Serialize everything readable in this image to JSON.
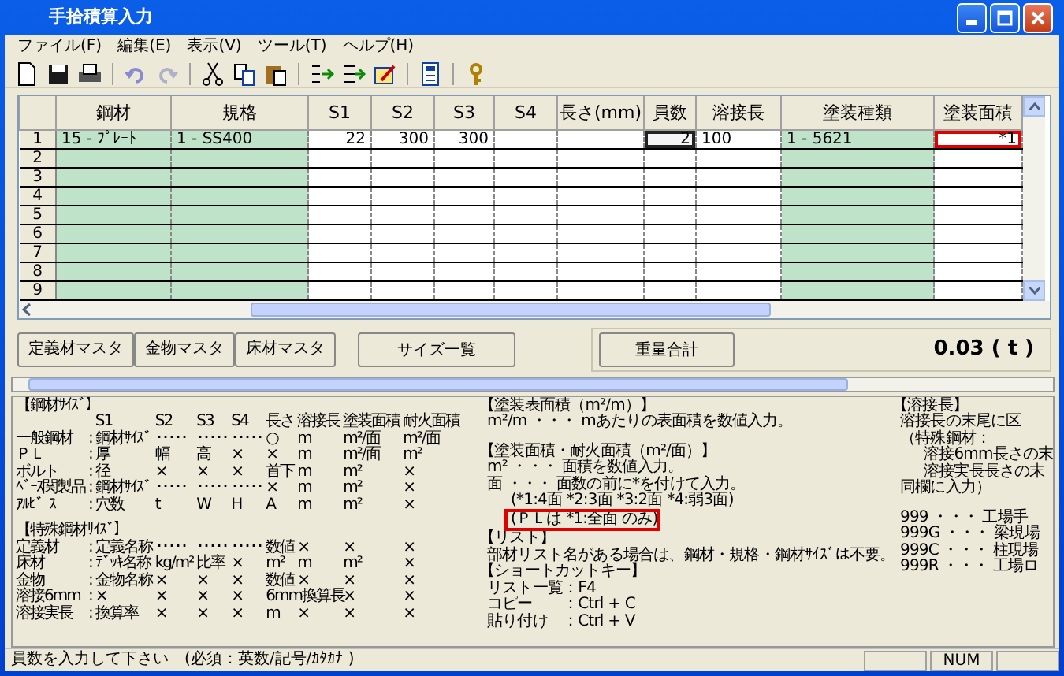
{
  "window": {
    "title": "手拾積算入力"
  },
  "menu": [
    "ファイル(F)",
    "編集(E)",
    "表示(V)",
    "ツール(T)",
    "ヘルプ(H)"
  ],
  "grid": {
    "columns": [
      {
        "label": "鋼材",
        "kind": "list"
      },
      {
        "label": "規格",
        "kind": "list"
      },
      {
        "label": "S1",
        "kind": "number"
      },
      {
        "label": "S2",
        "kind": "number"
      },
      {
        "label": "S3",
        "kind": "number"
      },
      {
        "label": "S4",
        "kind": "number"
      },
      {
        "label": "長さ(mm)",
        "kind": "number"
      },
      {
        "label": "員数",
        "kind": "number"
      },
      {
        "label": "溶接長",
        "kind": "text"
      },
      {
        "label": "塗装種類",
        "kind": "list"
      },
      {
        "label": "塗装面積",
        "kind": "number"
      }
    ],
    "rows": [
      {
        "label": "1",
        "cells": [
          {
            "text": "15 - ﾌﾟﾚｰﾄ",
            "selected": false,
            "highlighted": false
          },
          {
            "text": "1 - SS400",
            "selected": false,
            "highlighted": false
          },
          {
            "text": "22",
            "selected": false,
            "highlighted": false
          },
          {
            "text": "300",
            "selected": false,
            "highlighted": false
          },
          {
            "text": "300",
            "selected": false,
            "highlighted": false
          },
          null,
          null,
          {
            "text": "2",
            "selected": true,
            "highlighted": false
          },
          {
            "text": "100",
            "selected": false,
            "highlighted": false
          },
          {
            "text": "1 - 5621",
            "selected": false,
            "highlighted": false
          },
          {
            "text": "*1",
            "selected": false,
            "highlighted": true
          }
        ]
      },
      {
        "label": "2"
      },
      {
        "label": "3"
      },
      {
        "label": "4"
      },
      {
        "label": "5"
      },
      {
        "label": "6"
      },
      {
        "label": "7"
      },
      {
        "label": "8"
      },
      {
        "label": "9"
      }
    ]
  },
  "master_buttons": [
    "定義材マスタ",
    "金物マスタ",
    "床材マスタ",
    "サイズ一覧"
  ],
  "total_button": "重量合計",
  "total": "0.03 ( t )",
  "help": {
    "left": [
      {
        "title": "【鋼材ｻｲｽﾞ】",
        "columns": [
          "S1",
          "S2",
          "S3",
          "S4",
          "長さ",
          "溶接長",
          "塗装面積",
          "耐火面積"
        ],
        "rows": [
          {
            "name": "一般鋼材",
            "sep": ":",
            "cells": [
              "鋼材ｻｲｽﾞ",
              "･････",
              "･････",
              "･････",
              "○",
              "m",
              "m²/面",
              "m²/面"
            ]
          },
          {
            "name": "ＰＬ",
            "sep": ":",
            "cells": [
              "厚",
              "幅",
              "高",
              "×",
              "×",
              "m",
              "m²/面",
              "m²"
            ]
          },
          {
            "name": "ボルト",
            "sep": ":",
            "cells": [
              "径",
              "×",
              "×",
              "×",
              "首下",
              "m",
              "m²",
              "×"
            ]
          },
          {
            "name": "ﾍﾞｰｽ関製品",
            "sep": ":",
            "cells": [
              "鋼材ｻｲｽﾞ",
              "･････",
              "･････",
              "･････",
              "×",
              "m",
              "m²",
              "×"
            ]
          },
          {
            "name": "ｱﾙﾋﾞｰｽ",
            "sep": ":",
            "cells": [
              "穴数",
              "t",
              "W",
              "H",
              "A",
              "m",
              "m²",
              "×"
            ]
          }
        ]
      },
      {
        "title": "【特殊鋼材ｻｲｽﾞ】",
        "rows": [
          {
            "name": "定義材",
            "sep": ":",
            "cells": [
              "定義名称",
              "･････",
              "･････",
              "･････",
              "数値",
              "×",
              "×",
              "×"
            ]
          },
          {
            "name": "床材",
            "sep": ":",
            "cells": [
              "ﾃﾞｯｷ名称",
              "kg/m²",
              "比率",
              "×",
              "m²",
              "m",
              "m²",
              "×"
            ]
          },
          {
            "name": "金物",
            "sep": ":",
            "cells": [
              "金物名称",
              "×",
              "×",
              "×",
              "数値",
              "×",
              "×",
              "×"
            ]
          },
          {
            "name": "溶接6mm",
            "sep": ":",
            "cells": [
              "×",
              "×",
              "×",
              "×",
              "6mm換算長",
              null,
              "×",
              "×"
            ]
          },
          {
            "name": "溶接実長",
            "sep": ":",
            "cells": [
              "換算率",
              "×",
              "×",
              "×",
              "m",
              "×",
              "×",
              "×"
            ]
          }
        ]
      }
    ],
    "middle": [
      {
        "kind": "heading",
        "text": "【塗装表面積（m²/m）】",
        "highlighted": false
      },
      {
        "kind": "body",
        "text": "m²/m ・・・ mあたりの表面積を数値入力。",
        "highlighted": false
      },
      {
        "kind": "heading",
        "gap": true,
        "text": "【塗装面積・耐火面積（m²/面）】",
        "highlighted": false
      },
      {
        "kind": "body",
        "text": "m² ・・・ 面積を数値入力。",
        "highlighted": false
      },
      {
        "kind": "body",
        "text": "面 ・・・ 面数の前に*を付けて入力。",
        "highlighted": false
      },
      {
        "kind": "note",
        "text": "(*1:4面 *2:3面 *3:2面 *4:弱3面)",
        "highlighted": false
      },
      {
        "kind": "note",
        "text": "(ＰＬは *1:全面 のみ)",
        "highlighted": true
      },
      {
        "kind": "heading",
        "text": "【リスト】",
        "highlighted": false
      },
      {
        "kind": "body",
        "text": "部材リスト名がある場合は、鋼材・規格・鋼材ｻｲｽﾞは不要。",
        "highlighted": false
      },
      {
        "kind": "heading",
        "text": "【ショートカットキー】",
        "highlighted": false
      },
      {
        "kind": "body",
        "text": "リスト一覧：F4",
        "highlighted": false
      },
      {
        "kind": "body",
        "text": "コピー　　：Ctrl + C",
        "highlighted": false
      },
      {
        "kind": "body",
        "text": "貼り付け　：Ctrl + V",
        "highlighted": false
      }
    ],
    "right": [
      {
        "kind": "heading",
        "text": "【溶接長】"
      },
      {
        "kind": "body",
        "text": "溶接長の末尾に区"
      },
      {
        "kind": "body",
        "text": "（特殊鋼材："
      },
      {
        "kind": "note",
        "text": "溶接6mm長さの末"
      },
      {
        "kind": "note",
        "text": "溶接実長長さの末"
      },
      {
        "kind": "body",
        "text": "同欄に入力）"
      },
      {
        "kind": "body",
        "gap": true,
        "text": "999 ・・・ 工場手"
      },
      {
        "kind": "body",
        "text": "999G ・・・ 梁現場"
      },
      {
        "kind": "body",
        "text": "999C ・・・ 柱現場"
      },
      {
        "kind": "body",
        "text": "999R ・・・ 工場ロ"
      }
    ]
  },
  "status_bar": {
    "message": "員数を入力して下さい　(必須：英数/記号/ｶﾀｶﾅ )",
    "indicator": "NUM"
  }
}
